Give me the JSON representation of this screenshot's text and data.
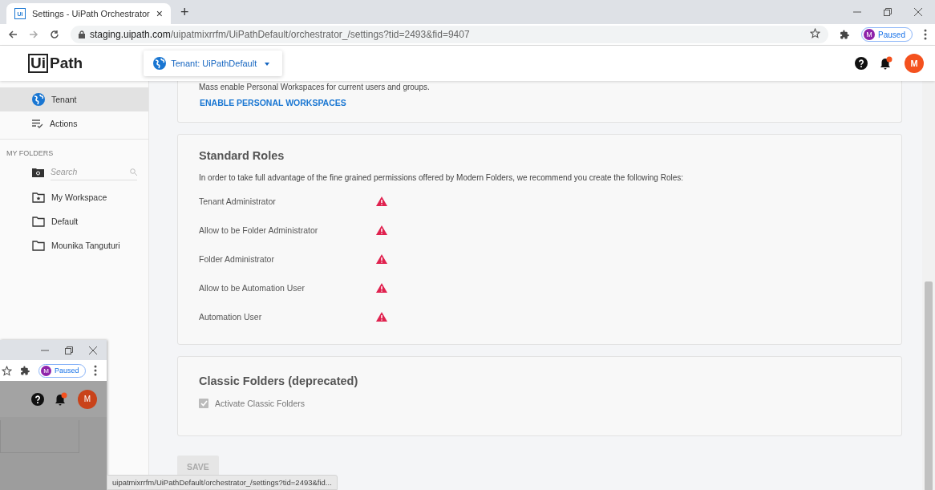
{
  "browser": {
    "tab_title": "Settings - UiPath Orchestrator",
    "tab_icon": "Ui",
    "tab_close": "×",
    "new_tab": "+",
    "url_host": "staging.uipath.com",
    "url_path": "/uipatmixrrfm/UiPathDefault/orchestrator_/settings?tid=2493&fid=9407",
    "profile_initial": "M",
    "profile_status": "Paused"
  },
  "app_header": {
    "logo_box": "Ui",
    "logo_text": "Path",
    "tenant": "Tenant: UiPathDefault",
    "avatar": "M"
  },
  "sidebar": {
    "items": [
      {
        "label": "Tenant",
        "kind": "globe",
        "selected": true
      },
      {
        "label": "Actions",
        "kind": "actions",
        "selected": false
      }
    ],
    "section_title": "MY FOLDERS",
    "search_placeholder": "Search",
    "folders": [
      {
        "label": "My Workspace",
        "kind": "workspace"
      },
      {
        "label": "Default",
        "kind": "folder"
      },
      {
        "label": "Mounika Tanguturi",
        "kind": "folder"
      }
    ]
  },
  "workspaces_card": {
    "description": "Mass enable Personal Workspaces for current users and groups.",
    "action": "ENABLE PERSONAL WORKSPACES"
  },
  "roles_card": {
    "title": "Standard Roles",
    "description": "In order to take full advantage of the fine grained permissions offered by Modern Folders, we recommend you create the following Roles:",
    "roles": [
      {
        "name": "Tenant Administrator",
        "warning": true
      },
      {
        "name": "Allow to be Folder Administrator",
        "warning": true
      },
      {
        "name": "Folder Administrator",
        "warning": true
      },
      {
        "name": "Allow to be Automation User",
        "warning": true
      },
      {
        "name": "Automation User",
        "warning": true
      }
    ]
  },
  "classic_card": {
    "title": "Classic Folders (deprecated)",
    "checkbox": {
      "label": "Activate Classic Folders",
      "checked": true,
      "disabled": true
    }
  },
  "save_button": {
    "label": "SAVE",
    "disabled": true
  },
  "status_url": "uipatmixrrfm/UiPathDefault/orchestrator_/settings?tid=2493&fid...",
  "preview": {
    "profile_initial": "M",
    "profile_status": "Paused",
    "avatar": "M"
  }
}
